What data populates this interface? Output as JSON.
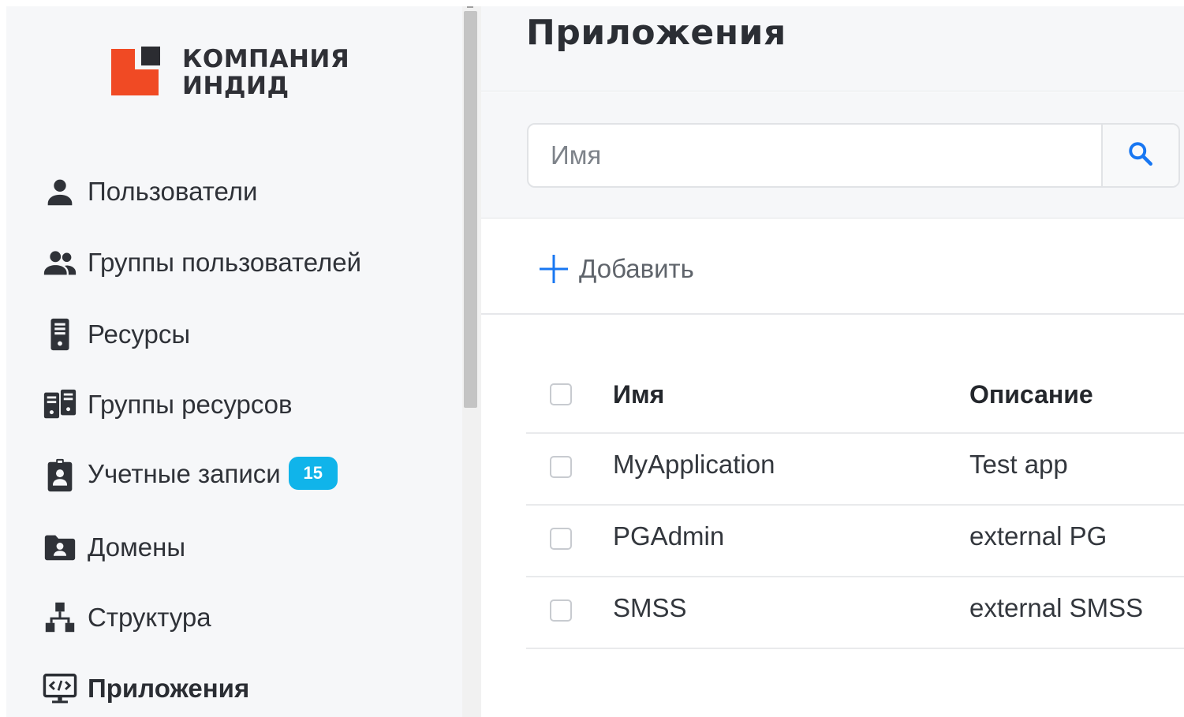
{
  "brand": {
    "line1": "КОМПАНИЯ",
    "line2": "ИНДИД",
    "colors": {
      "accent_red": "#f04a24",
      "accent_dark": "#2b2c31"
    }
  },
  "sidebar": {
    "items": [
      {
        "label": "Пользователи",
        "icon": "user-icon"
      },
      {
        "label": "Группы пользователей",
        "icon": "users-group-icon"
      },
      {
        "label": "Ресурсы",
        "icon": "server-icon"
      },
      {
        "label": "Группы ресурсов",
        "icon": "server-group-icon"
      },
      {
        "label": "Учетные записи",
        "icon": "id-badge-icon",
        "badge": "15"
      },
      {
        "label": "Домены",
        "icon": "folder-user-icon"
      },
      {
        "label": "Структура",
        "icon": "hierarchy-icon"
      },
      {
        "label": "Приложения",
        "icon": "code-monitor-icon",
        "active": true
      }
    ],
    "badge_color": "#10b4ea"
  },
  "page": {
    "title": "Приложения"
  },
  "search": {
    "placeholder": "Имя",
    "icon": "search-icon",
    "icon_color": "#1877f2"
  },
  "toolbar": {
    "add_label": "Добавить",
    "add_icon": "plus-icon"
  },
  "table": {
    "columns": [
      "Имя",
      "Описание"
    ],
    "rows": [
      {
        "name": "MyApplication",
        "description": "Test app"
      },
      {
        "name": "PGAdmin",
        "description": "external PG"
      },
      {
        "name": "SMSS",
        "description": "external SMSS"
      }
    ]
  }
}
